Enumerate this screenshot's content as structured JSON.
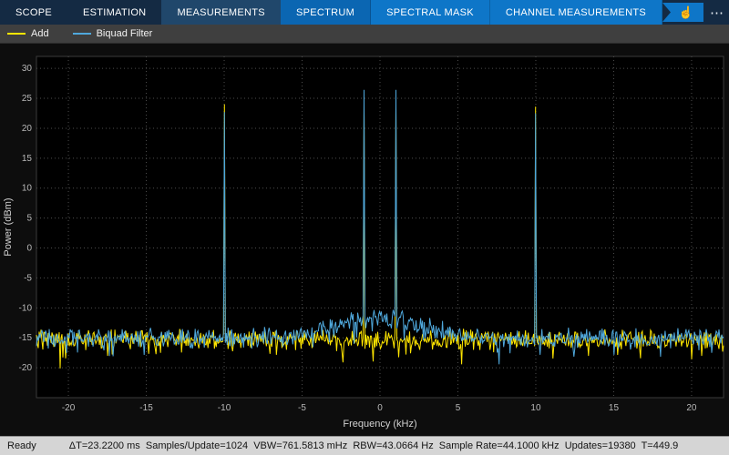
{
  "toolbar": {
    "tabs": [
      {
        "label": "SCOPE"
      },
      {
        "label": "ESTIMATION"
      },
      {
        "label": "MEASUREMENTS"
      },
      {
        "label": "SPECTRUM"
      },
      {
        "label": "SPECTRAL MASK"
      },
      {
        "label": "CHANNEL MEASUREMENTS"
      }
    ],
    "hand_glyph": "☝",
    "more_label": "⋯"
  },
  "legend": {
    "items": [
      {
        "label": "Add",
        "color": "#ffe600"
      },
      {
        "label": "Biquad Filter",
        "color": "#4fa8dc"
      }
    ]
  },
  "chart_data": {
    "type": "line",
    "title": "",
    "xlabel": "Frequency (kHz)",
    "ylabel": "Power (dBm)",
    "xlim": [
      -22.05,
      22.05
    ],
    "ylim": [
      -25,
      32
    ],
    "xticks": [
      -20,
      -15,
      -10,
      -5,
      0,
      5,
      10,
      15,
      20
    ],
    "yticks": [
      30,
      25,
      20,
      15,
      10,
      5,
      0,
      -5,
      -10,
      -15,
      -20
    ],
    "grid": true,
    "legend_position": "top-left-bar",
    "background": "#000000",
    "series": [
      {
        "name": "Add",
        "color": "#ffe600",
        "noise_floor_dbm": -15.3,
        "peaks": [
          {
            "freq_khz": -10,
            "power_dbm": 24.0
          },
          {
            "freq_khz": -1,
            "power_dbm": 23.8
          },
          {
            "freq_khz": 1,
            "power_dbm": 23.8
          },
          {
            "freq_khz": 10,
            "power_dbm": 23.6
          }
        ]
      },
      {
        "name": "Biquad Filter",
        "color": "#4fa8dc",
        "noise_floor_dbm": -15.0,
        "center_bump_db": 3.4,
        "bump_sigma_khz": 2.6,
        "peaks": [
          {
            "freq_khz": -10,
            "power_dbm": 22.7
          },
          {
            "freq_khz": -1,
            "power_dbm": 26.4
          },
          {
            "freq_khz": 1,
            "power_dbm": 26.4
          },
          {
            "freq_khz": 10,
            "power_dbm": 22.5
          }
        ]
      }
    ]
  },
  "status_bar": {
    "ready": "Ready",
    "measurements": "ΔT=23.2200 ms  Samples/Update=1024  VBW=761.5813 mHz  RBW=43.0664 Hz  Sample Rate=44.1000 kHz  Updates=19380  T=449.9"
  }
}
